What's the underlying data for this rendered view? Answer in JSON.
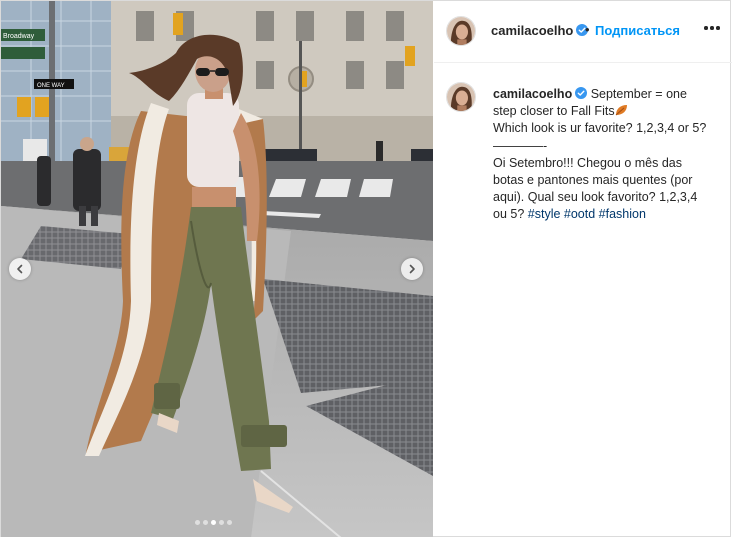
{
  "post": {
    "username": "camilacoelho",
    "separator": "•",
    "follow_label": "Подписаться",
    "caption": {
      "line1": "September = one",
      "line2": "step closer to Fall Fits",
      "line3": "Which look is ur favorite? 1,2,3,4 or 5?",
      "line4": "————-",
      "line5": "Oi Setembro!!! Chegou o mês das",
      "line6": "botas e pantones mais quentes (por",
      "line7": "aqui). Qual seu look favorito? 1,2,3,4",
      "line8": "ou 5?",
      "hashtags": [
        "#style",
        "#ootd",
        "#fashion"
      ]
    },
    "carousel": {
      "total": 5,
      "active": 3
    }
  },
  "icons": {
    "verified": "verified-badge-icon",
    "leaf": "fallen-leaf-emoji",
    "prev": "chevron-left-icon",
    "next": "chevron-right-icon",
    "more": "more-options-icon"
  },
  "colors": {
    "link": "#0095f6",
    "hashtag": "#00376b",
    "text": "#262626",
    "border": "#dbdbdb"
  },
  "street_signs": {
    "sign1": "Broadway",
    "sign2": "ONE WAY"
  }
}
